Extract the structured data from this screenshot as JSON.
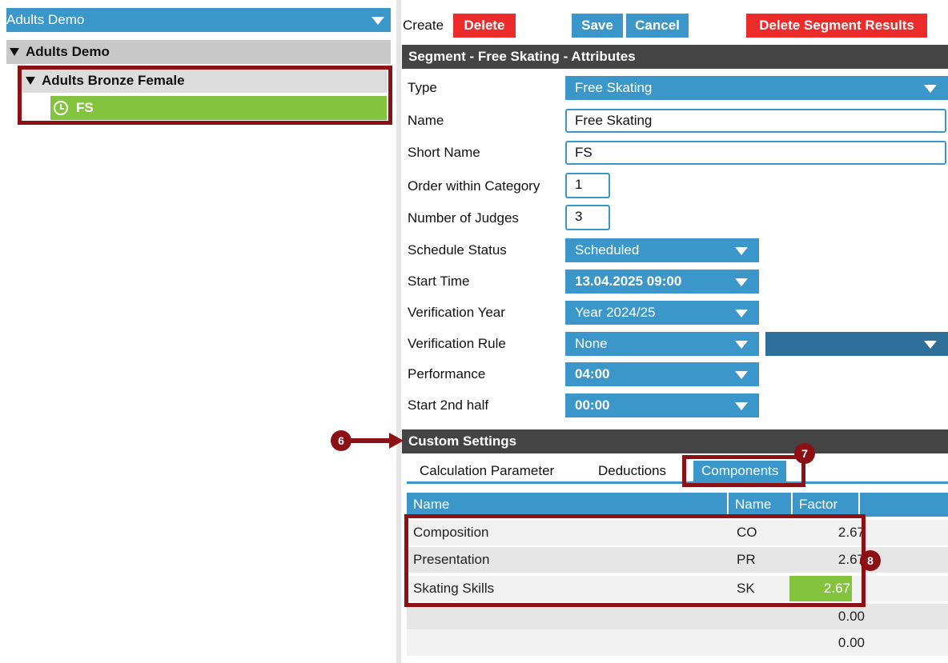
{
  "tree": {
    "dropdown_label": "Adults Demo",
    "root_label": "Adults Demo",
    "category_label": "Adults Bronze Female",
    "segment_label": "FS"
  },
  "toolbar": {
    "create_label": "Create",
    "delete_label": "Delete",
    "save_label": "Save",
    "cancel_label": "Cancel",
    "delete_results_label": "Delete Segment Results"
  },
  "attributes": {
    "header": "Segment - Free Skating - Attributes",
    "type_label": "Type",
    "type_value": "Free Skating",
    "name_label": "Name",
    "name_value": "Free Skating",
    "short_name_label": "Short Name",
    "short_name_value": "FS",
    "order_label": "Order within Category",
    "order_value": "1",
    "judges_label": "Number of Judges",
    "judges_value": "3",
    "schedule_label": "Schedule Status",
    "schedule_value": "Scheduled",
    "start_time_label": "Start Time",
    "start_time_value": "13.04.2025 09:00",
    "verif_year_label": "Verification Year",
    "verif_year_value": "Year 2024/25",
    "verif_rule_label": "Verification Rule",
    "verif_rule_value": "None",
    "performance_label": "Performance",
    "performance_value": "04:00",
    "second_half_label": "Start 2nd half",
    "second_half_value": "00:00"
  },
  "custom": {
    "header": "Custom Settings",
    "tabs": [
      "Calculation Parameter",
      "Deductions",
      "Components"
    ],
    "columns": [
      "Name",
      "Name",
      "Factor"
    ],
    "rows": [
      {
        "name": "Composition",
        "abbr": "CO",
        "factor": "2.67"
      },
      {
        "name": "Presentation",
        "abbr": "PR",
        "factor": "2.67"
      },
      {
        "name": "Skating Skills",
        "abbr": "SK",
        "factor": "2.67"
      },
      {
        "name": "",
        "abbr": "",
        "factor": "0.00"
      },
      {
        "name": "",
        "abbr": "",
        "factor": "0.00"
      }
    ]
  },
  "callouts": [
    "6",
    "7",
    "8"
  ],
  "colors": {
    "accent": "#3b97c9",
    "danger": "#ec2b2b",
    "highlight": "#8b1115",
    "selected": "#84c33d"
  }
}
